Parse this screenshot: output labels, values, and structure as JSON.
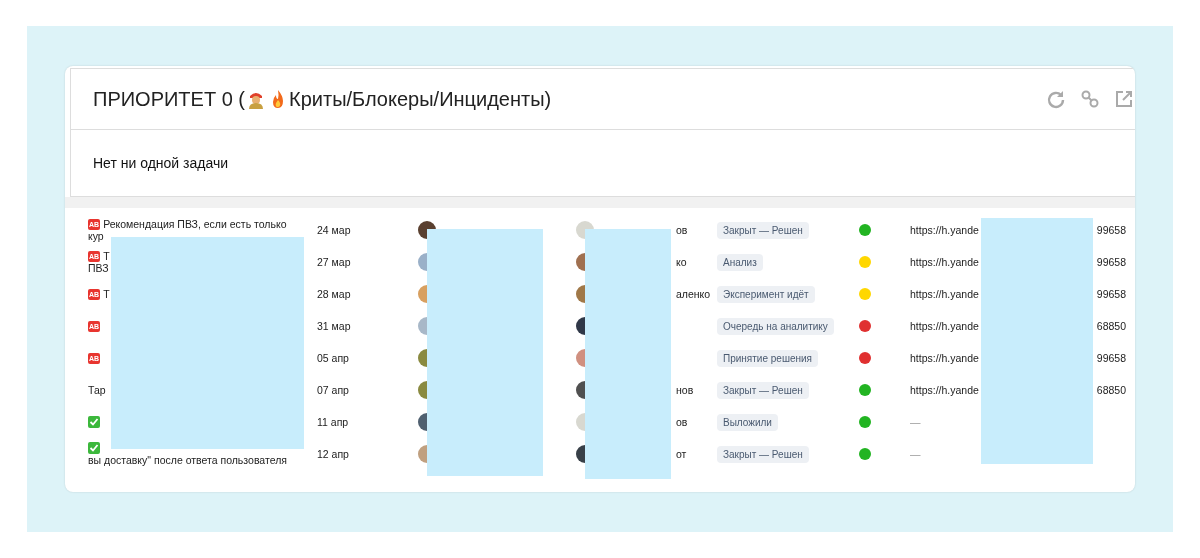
{
  "widget": {
    "title_prefix": "ПРИОРИТЕТ 0 (",
    "title_suffix": "Криты/Блокеры/Инциденты)",
    "empty_message": "Нет ни одной задачи"
  },
  "rows": [
    {
      "kind": "ab",
      "badge": "AB",
      "title": "Рекомендация ПВЗ, если есть только",
      "title_line2": "кур",
      "date": "24 мар",
      "assignee": "ов",
      "status": "Закрыт — Решен",
      "color": "#22b422",
      "url": "https://h.yande",
      "url_end": "99658"
    },
    {
      "kind": "ab",
      "badge": "AB",
      "title": "Т",
      "title_line2": "ПВЗ",
      "date": "27 мар",
      "assignee": "ко",
      "status": "Анализ",
      "color": "#ffd700",
      "url": "https://h.yande",
      "url_end": "99658"
    },
    {
      "kind": "ab",
      "badge": "AB",
      "title": "Т",
      "date": "28 мар",
      "assignee": "аленко",
      "status": "Эксперимент идёт",
      "color": "#ffd700",
      "url": "https://h.yande",
      "url_end": "99658"
    },
    {
      "kind": "ab",
      "badge": "AB",
      "date": "31 мар",
      "status": "Очередь на аналитику",
      "color": "#e03030",
      "url": "https://h.yande",
      "url_end": "68850"
    },
    {
      "kind": "ab",
      "badge": "AB",
      "date": "05 апр",
      "status": "Принятие решения",
      "color": "#e03030",
      "url": "https://h.yande",
      "url_end": "99658"
    },
    {
      "kind": "plain",
      "title": "Тар",
      "date": "07 апр",
      "assignee": "нов",
      "status": "Закрыт — Решен",
      "color": "#22b422",
      "url": "https://h.yande",
      "url_end": "68850"
    },
    {
      "kind": "done",
      "date": "11 апр",
      "assignee": "ов",
      "status": "Выложили",
      "color": "#22b422",
      "url": "—"
    },
    {
      "kind": "done",
      "title_line2": "вы доставку\" после ответа пользователя",
      "date": "12 апр",
      "assignee": "от",
      "status": "Закрыт — Решен",
      "color": "#22b422",
      "url": "—"
    }
  ]
}
